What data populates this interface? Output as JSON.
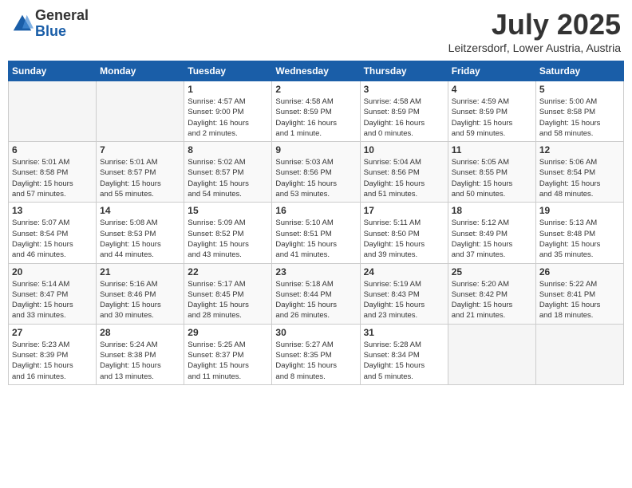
{
  "logo": {
    "general": "General",
    "blue": "Blue"
  },
  "title": {
    "month": "July 2025",
    "location": "Leitzersdorf, Lower Austria, Austria"
  },
  "headers": [
    "Sunday",
    "Monday",
    "Tuesday",
    "Wednesday",
    "Thursday",
    "Friday",
    "Saturday"
  ],
  "weeks": [
    [
      {
        "day": "",
        "info": ""
      },
      {
        "day": "",
        "info": ""
      },
      {
        "day": "1",
        "info": "Sunrise: 4:57 AM\nSunset: 9:00 PM\nDaylight: 16 hours\nand 2 minutes."
      },
      {
        "day": "2",
        "info": "Sunrise: 4:58 AM\nSunset: 8:59 PM\nDaylight: 16 hours\nand 1 minute."
      },
      {
        "day": "3",
        "info": "Sunrise: 4:58 AM\nSunset: 8:59 PM\nDaylight: 16 hours\nand 0 minutes."
      },
      {
        "day": "4",
        "info": "Sunrise: 4:59 AM\nSunset: 8:59 PM\nDaylight: 15 hours\nand 59 minutes."
      },
      {
        "day": "5",
        "info": "Sunrise: 5:00 AM\nSunset: 8:58 PM\nDaylight: 15 hours\nand 58 minutes."
      }
    ],
    [
      {
        "day": "6",
        "info": "Sunrise: 5:01 AM\nSunset: 8:58 PM\nDaylight: 15 hours\nand 57 minutes."
      },
      {
        "day": "7",
        "info": "Sunrise: 5:01 AM\nSunset: 8:57 PM\nDaylight: 15 hours\nand 55 minutes."
      },
      {
        "day": "8",
        "info": "Sunrise: 5:02 AM\nSunset: 8:57 PM\nDaylight: 15 hours\nand 54 minutes."
      },
      {
        "day": "9",
        "info": "Sunrise: 5:03 AM\nSunset: 8:56 PM\nDaylight: 15 hours\nand 53 minutes."
      },
      {
        "day": "10",
        "info": "Sunrise: 5:04 AM\nSunset: 8:56 PM\nDaylight: 15 hours\nand 51 minutes."
      },
      {
        "day": "11",
        "info": "Sunrise: 5:05 AM\nSunset: 8:55 PM\nDaylight: 15 hours\nand 50 minutes."
      },
      {
        "day": "12",
        "info": "Sunrise: 5:06 AM\nSunset: 8:54 PM\nDaylight: 15 hours\nand 48 minutes."
      }
    ],
    [
      {
        "day": "13",
        "info": "Sunrise: 5:07 AM\nSunset: 8:54 PM\nDaylight: 15 hours\nand 46 minutes."
      },
      {
        "day": "14",
        "info": "Sunrise: 5:08 AM\nSunset: 8:53 PM\nDaylight: 15 hours\nand 44 minutes."
      },
      {
        "day": "15",
        "info": "Sunrise: 5:09 AM\nSunset: 8:52 PM\nDaylight: 15 hours\nand 43 minutes."
      },
      {
        "day": "16",
        "info": "Sunrise: 5:10 AM\nSunset: 8:51 PM\nDaylight: 15 hours\nand 41 minutes."
      },
      {
        "day": "17",
        "info": "Sunrise: 5:11 AM\nSunset: 8:50 PM\nDaylight: 15 hours\nand 39 minutes."
      },
      {
        "day": "18",
        "info": "Sunrise: 5:12 AM\nSunset: 8:49 PM\nDaylight: 15 hours\nand 37 minutes."
      },
      {
        "day": "19",
        "info": "Sunrise: 5:13 AM\nSunset: 8:48 PM\nDaylight: 15 hours\nand 35 minutes."
      }
    ],
    [
      {
        "day": "20",
        "info": "Sunrise: 5:14 AM\nSunset: 8:47 PM\nDaylight: 15 hours\nand 33 minutes."
      },
      {
        "day": "21",
        "info": "Sunrise: 5:16 AM\nSunset: 8:46 PM\nDaylight: 15 hours\nand 30 minutes."
      },
      {
        "day": "22",
        "info": "Sunrise: 5:17 AM\nSunset: 8:45 PM\nDaylight: 15 hours\nand 28 minutes."
      },
      {
        "day": "23",
        "info": "Sunrise: 5:18 AM\nSunset: 8:44 PM\nDaylight: 15 hours\nand 26 minutes."
      },
      {
        "day": "24",
        "info": "Sunrise: 5:19 AM\nSunset: 8:43 PM\nDaylight: 15 hours\nand 23 minutes."
      },
      {
        "day": "25",
        "info": "Sunrise: 5:20 AM\nSunset: 8:42 PM\nDaylight: 15 hours\nand 21 minutes."
      },
      {
        "day": "26",
        "info": "Sunrise: 5:22 AM\nSunset: 8:41 PM\nDaylight: 15 hours\nand 18 minutes."
      }
    ],
    [
      {
        "day": "27",
        "info": "Sunrise: 5:23 AM\nSunset: 8:39 PM\nDaylight: 15 hours\nand 16 minutes."
      },
      {
        "day": "28",
        "info": "Sunrise: 5:24 AM\nSunset: 8:38 PM\nDaylight: 15 hours\nand 13 minutes."
      },
      {
        "day": "29",
        "info": "Sunrise: 5:25 AM\nSunset: 8:37 PM\nDaylight: 15 hours\nand 11 minutes."
      },
      {
        "day": "30",
        "info": "Sunrise: 5:27 AM\nSunset: 8:35 PM\nDaylight: 15 hours\nand 8 minutes."
      },
      {
        "day": "31",
        "info": "Sunrise: 5:28 AM\nSunset: 8:34 PM\nDaylight: 15 hours\nand 5 minutes."
      },
      {
        "day": "",
        "info": ""
      },
      {
        "day": "",
        "info": ""
      }
    ]
  ]
}
